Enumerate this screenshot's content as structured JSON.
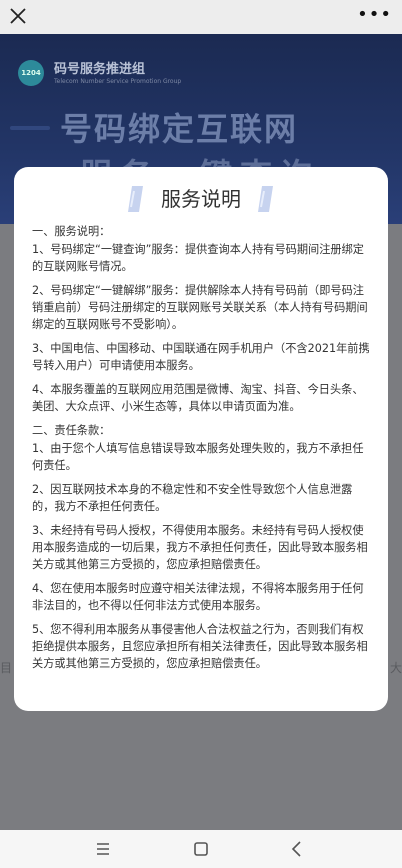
{
  "topbar": {
    "close_icon": "close-icon",
    "more_label": "•••"
  },
  "background_page": {
    "logo_text": "1204",
    "org_name": "码号服务推进组",
    "org_name_en": "Telecom Number Service Promotion Group",
    "banner_line1": "号码绑定互联网",
    "banner_line2": "服务一键查询",
    "peek_left": "目",
    "peek_right": "大"
  },
  "modal": {
    "title": "服务说明",
    "paragraphs": [
      "一、服务说明：",
      "1、号码绑定“一键查询”服务：提供查询本人持有号码期间注册绑定的互联网账号情况。",
      "2、号码绑定“一键解绑”服务：提供解除本人持有号码前（即号码注销重启前）号码注册绑定的互联网账号关联关系（本人持有号码期间绑定的互联网账号不受影响）。",
      "3、中国电信、中国移动、中国联通在网手机用户（不含2021年前携号转入用户）可申请使用本服务。",
      "4、本服务覆盖的互联网应用范围是微博、淘宝、抖音、今日头条、美团、大众点评、小米生态等，具体以申请页面为准。",
      "二、责任条款：",
      "1、由于您个人填写信息错误导致本服务处理失败的，我方不承担任何责任。",
      "2、因互联网技术本身的不稳定性和不安全性导致您个人信息泄露的，我方不承担任何责任。",
      "3、未经持有号码人授权，不得使用本服务。未经持有号码人授权使用本服务造成的一切后果，我方不承担任何责任，因此导致本服务相关方或其他第三方受损的，您应承担赔偿责任。",
      "4、您在使用本服务时应遵守相关法律法规，不得将本服务用于任何非法目的，也不得以任何非法方式使用本服务。",
      "5、您不得利用本服务从事侵害他人合法权益之行为，否则我们有权拒绝提供本服务，且您应承担所有相关法律责任，因此导致本服务相关方或其他第三方受损的，您应承担赔偿责任。"
    ]
  },
  "navbar": {
    "menu_icon": "menu-icon",
    "home_icon": "home-square-icon",
    "back_icon": "back-chevron-icon"
  }
}
